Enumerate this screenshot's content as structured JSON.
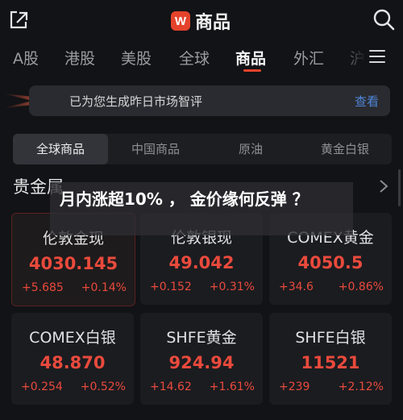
{
  "header": {
    "title": "商品",
    "logo_letter": "W"
  },
  "tabs": [
    {
      "label": "A股"
    },
    {
      "label": "港股"
    },
    {
      "label": "美股"
    },
    {
      "label": "全球"
    },
    {
      "label": "商品",
      "active": true
    },
    {
      "label": "外汇"
    },
    {
      "label": "沪"
    }
  ],
  "banner": {
    "text": "已为您生成昨日市场智评",
    "link": "查看"
  },
  "segments": [
    {
      "label": "全球商品",
      "active": true
    },
    {
      "label": "中国商品"
    },
    {
      "label": "原油"
    },
    {
      "label": "黄金白银"
    }
  ],
  "section": {
    "title": "贵金属"
  },
  "headline": "月内涨超10% ， 金价缘何反弹 ？",
  "cards": [
    {
      "name": "伦敦金现",
      "price": "4030.145",
      "change": "+5.685",
      "pct": "+0.14%"
    },
    {
      "name": "伦敦银现",
      "price": "49.042",
      "change": "+0.152",
      "pct": "+0.31%"
    },
    {
      "name": "COMEX黄金",
      "price": "4050.5",
      "change": "+34.6",
      "pct": "+0.86%"
    },
    {
      "name": "COMEX白银",
      "price": "48.870",
      "change": "+0.254",
      "pct": "+0.52%"
    },
    {
      "name": "SHFE黄金",
      "price": "924.94",
      "change": "+14.62",
      "pct": "+1.61%"
    },
    {
      "name": "SHFE白银",
      "price": "11521",
      "change": "+239",
      "pct": "+2.12%"
    }
  ],
  "colors": {
    "accent": "#e5432b",
    "up": "#ea4a3c",
    "link": "#4f86d8",
    "background": "#121316"
  }
}
